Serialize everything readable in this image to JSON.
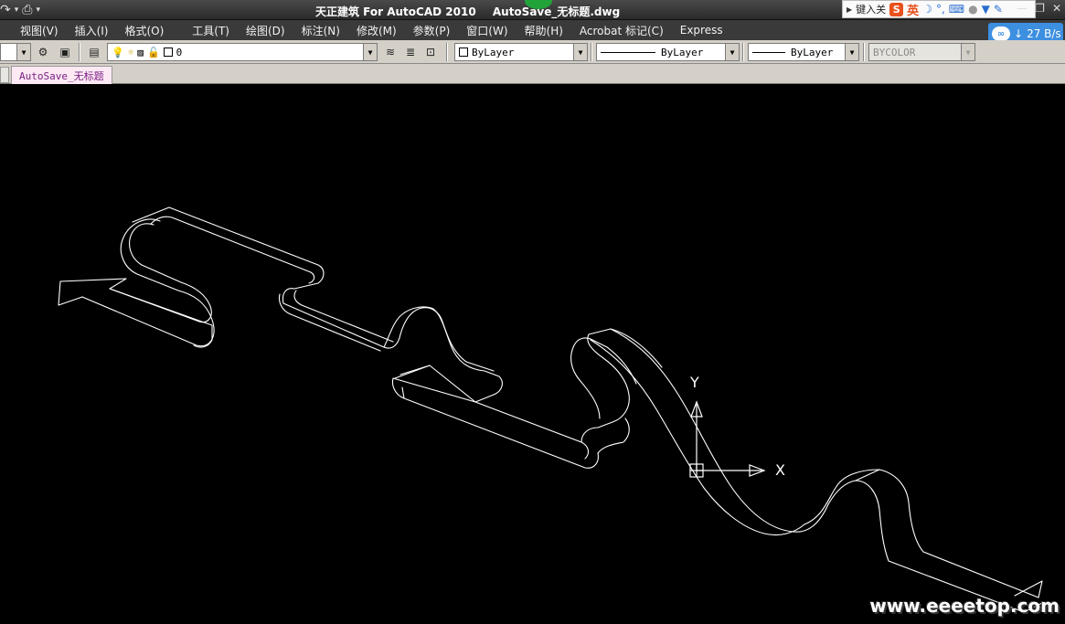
{
  "titlebar": {
    "app_title": "天正建筑 For AutoCAD 2010",
    "file_title": "AutoSave_无标题.dwg",
    "icons": [
      "redo-icon",
      "print-icon",
      "dropdown-icon"
    ]
  },
  "ime": {
    "text": "键入关",
    "logo": "S",
    "mode": "英",
    "icons": [
      "moon-icon",
      "punctuation-icon",
      "keyboard-icon",
      "user-icon",
      "shirt-icon",
      "wrench-icon"
    ]
  },
  "window_controls": [
    "minimize",
    "restore",
    "close"
  ],
  "menu": [
    "视图(V)",
    "插入(I)",
    "格式(O)",
    "工具(T)",
    "绘图(D)",
    "标注(N)",
    "修改(M)",
    "参数(P)",
    "窗口(W)",
    "帮助(H)",
    "Acrobat 标记(C)",
    "Express"
  ],
  "netspeed": {
    "value": "27 B/s",
    "logo": "∞"
  },
  "toolbar": {
    "layer_value": "0",
    "color_value": "ByLayer",
    "linetype_value": "ByLayer",
    "lineweight_value": "ByLayer",
    "plotstyle_value": "BYCOLOR"
  },
  "tabs": [
    {
      "label": "AutoSave_无标题"
    }
  ],
  "canvas": {
    "ucs_x_label": "X",
    "ucs_y_label": "Y"
  },
  "watermark": "www.eeeetop.com"
}
